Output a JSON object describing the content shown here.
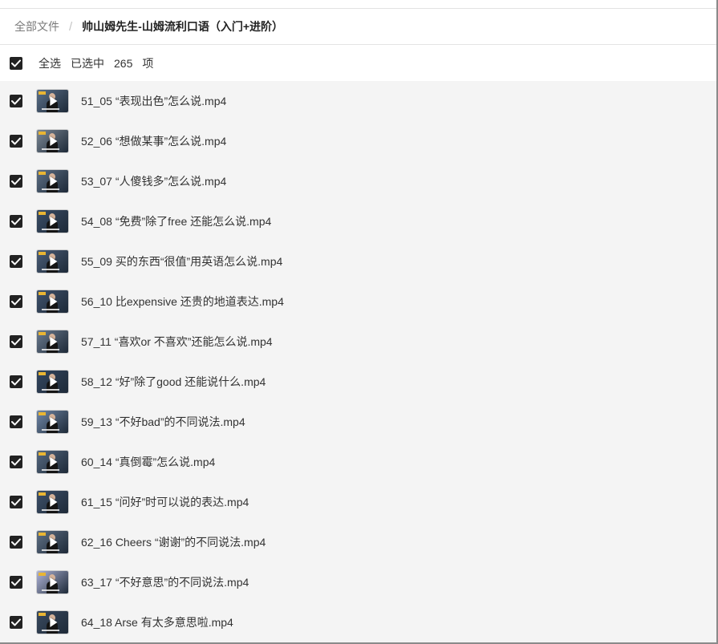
{
  "breadcrumb": {
    "root": "全部文件",
    "separator": "/",
    "current": "帅山姆先生-山姆流利口语（入门+进阶）"
  },
  "selection": {
    "select_all_label": "全选",
    "selected_label": "已选中",
    "count": "265",
    "unit": "项",
    "all_checked": true
  },
  "files": [
    {
      "name": "51_05 “表现出色”怎么说.mp4",
      "checked": true,
      "thumb_bg": "#5a6f88"
    },
    {
      "name": "52_06 “想做某事”怎么说.mp4",
      "checked": true,
      "thumb_bg": "#7b8794"
    },
    {
      "name": "53_07 “人傻钱多”怎么说.mp4",
      "checked": true,
      "thumb_bg": "#5c6e84"
    },
    {
      "name": "54_08 “免费”除了free 还能怎么说.mp4",
      "checked": true,
      "thumb_bg": "#3a4d66"
    },
    {
      "name": "55_09 买的东西“很值”用英语怎么说.mp4",
      "checked": true,
      "thumb_bg": "#4a5d77"
    },
    {
      "name": "56_10 比expensive 还贵的地道表达.mp4",
      "checked": true,
      "thumb_bg": "#3f526c"
    },
    {
      "name": "57_11 “喜欢or 不喜欢”还能怎么说.mp4",
      "checked": true,
      "thumb_bg": "#6a7a8e"
    },
    {
      "name": "58_12 “好”除了good 还能说什么.mp4",
      "checked": true,
      "thumb_bg": "#33465f"
    },
    {
      "name": "59_13 “不好bad”的不同说法.mp4",
      "checked": true,
      "thumb_bg": "#6f86a6"
    },
    {
      "name": "60_14 “真倒霉”怎么说.mp4",
      "checked": true,
      "thumb_bg": "#55687f"
    },
    {
      "name": "61_15 “问好”时可以说的表达.mp4",
      "checked": true,
      "thumb_bg": "#3d5069"
    },
    {
      "name": "62_16 Cheers “谢谢”的不同说法.mp4",
      "checked": true,
      "thumb_bg": "#5e6f84"
    },
    {
      "name": "63_17 “不好意思”的不同说法.mp4",
      "checked": true,
      "thumb_bg": "#aeb3d6"
    },
    {
      "name": "64_18 Arse 有太多意思啦.mp4",
      "checked": true,
      "thumb_bg": "#39495e"
    }
  ]
}
